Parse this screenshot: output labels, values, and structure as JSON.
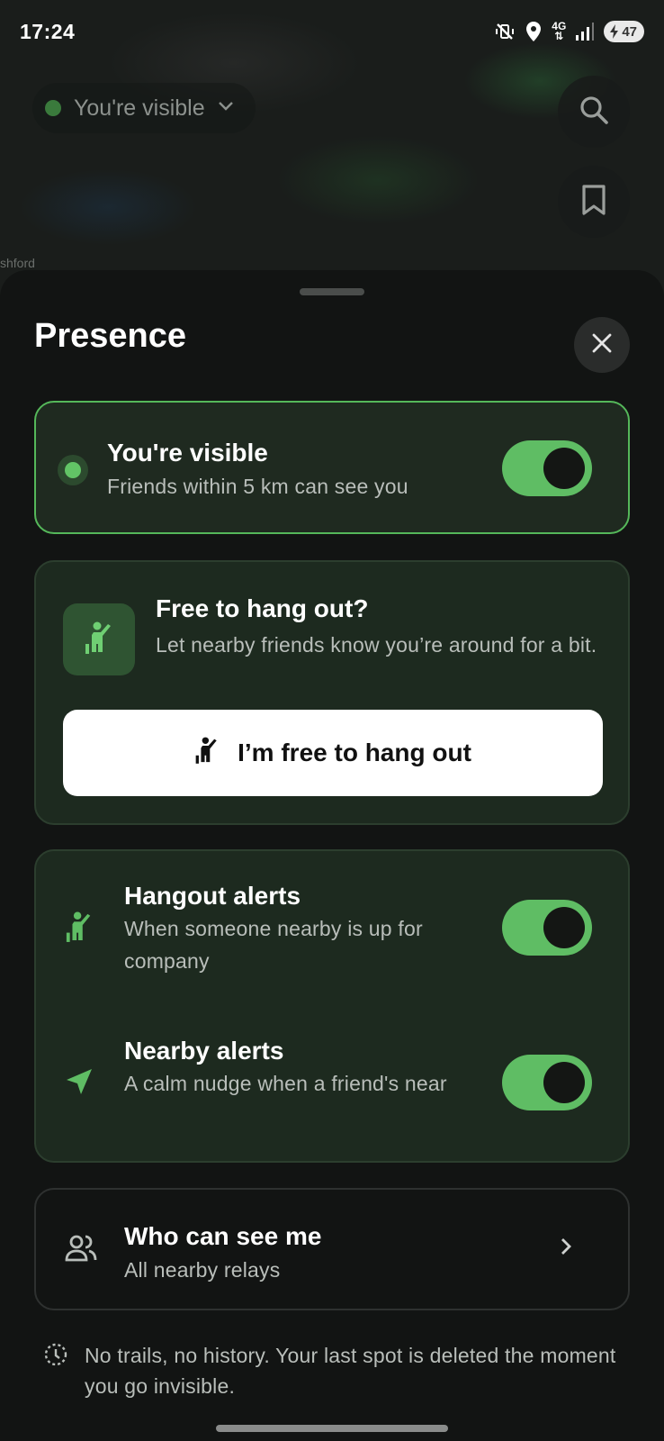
{
  "status_bar": {
    "time": "17:24",
    "network": "4G",
    "battery": "47",
    "icons": [
      "vibrate-off-icon",
      "location-icon",
      "network-4g-icon",
      "signal-icon",
      "battery-charging-icon"
    ]
  },
  "map": {
    "visibility_pill": {
      "label": "You're visible",
      "dot_color": "#3a7a3c"
    },
    "place_label": "shford",
    "buttons": [
      "search-icon",
      "bookmark-icon"
    ]
  },
  "sheet": {
    "title": "Presence",
    "visible_card": {
      "title": "You're visible",
      "subtitle": "Friends within 5 km can see you",
      "toggle_on": true
    },
    "hangout_card": {
      "title": "Free to hang out?",
      "subtitle": "Let nearby friends know you’re around for a bit.",
      "button_label": "I’m free to hang out"
    },
    "alerts": [
      {
        "title": "Hangout alerts",
        "subtitle": "When someone nearby is up for company",
        "toggle_on": true,
        "icon": "hangout-person-icon"
      },
      {
        "title": "Nearby alerts",
        "subtitle": "A calm nudge when a friend's near",
        "toggle_on": true,
        "icon": "navigation-arrow-icon"
      }
    ],
    "who_card": {
      "title": "Who can see me",
      "subtitle": "All nearby relays"
    },
    "privacy_note": "No trails, no history. Your last spot is deleted the moment you go invisible."
  },
  "colors": {
    "accent_green": "#5fbd64",
    "card_green": "#1d2a1f",
    "sheet_bg": "#121413"
  }
}
